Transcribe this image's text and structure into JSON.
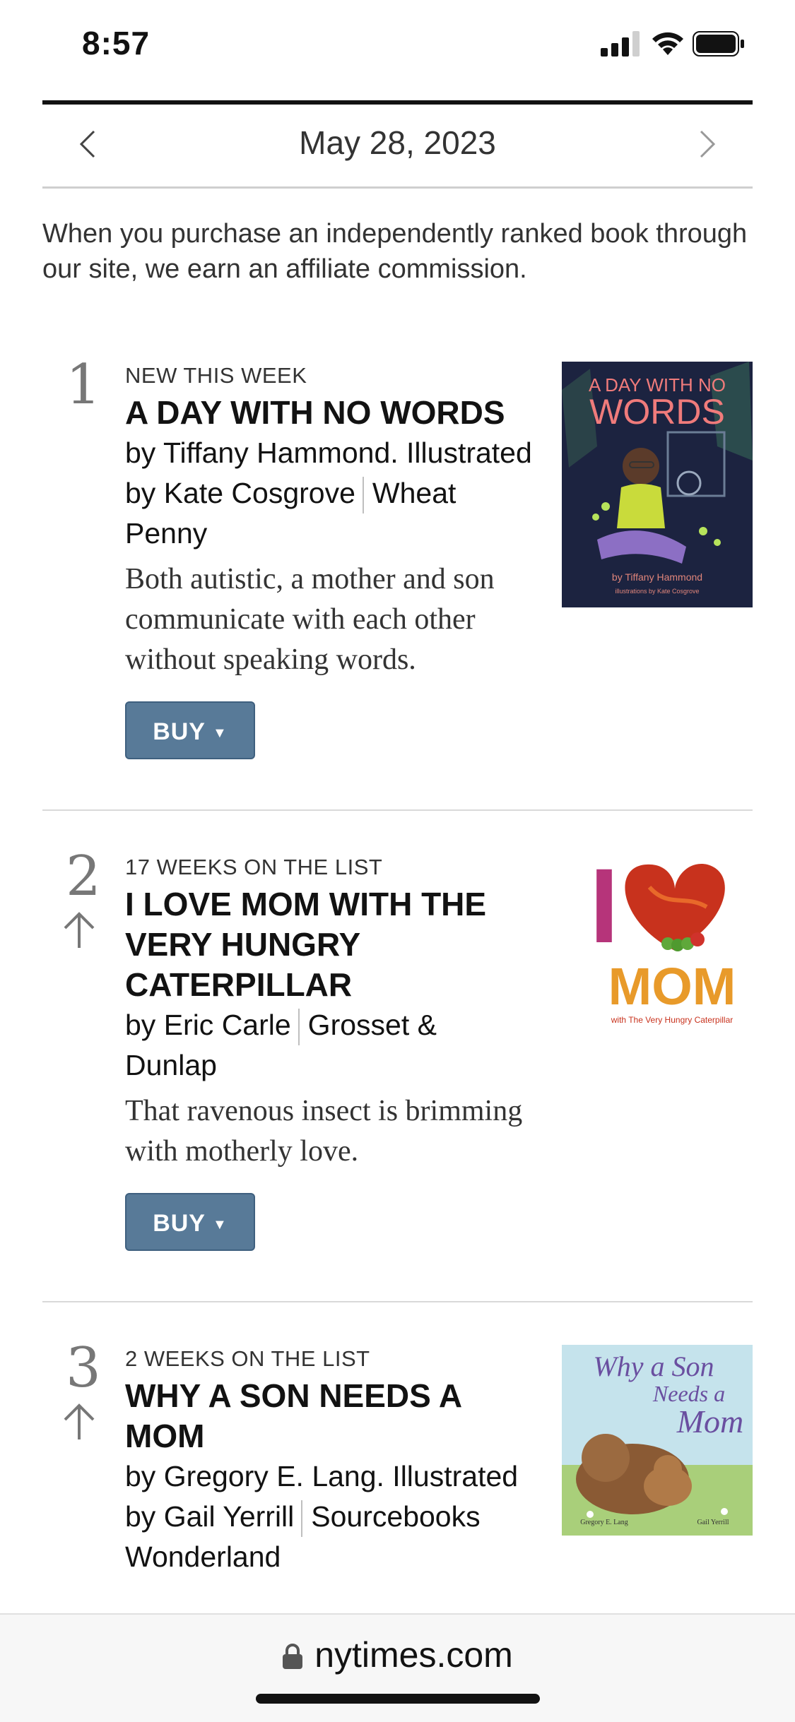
{
  "status": {
    "time": "8:57"
  },
  "nav": {
    "date": "May 28, 2023"
  },
  "disclaimer": "When you purchase an independently ranked book through our site, we earn an affiliate commission.",
  "books": [
    {
      "rank": "1",
      "weeks": "NEW THIS WEEK",
      "title": "A DAY WITH NO WORDS",
      "author": "by Tiffany Hammond. Illustrated by Kate Cosgrove",
      "publisher": "Wheat Penny",
      "description": "Both autistic, a mother and son communicate with each other without speaking words.",
      "buy_label": "BUY",
      "cover": {
        "title_line1": "A DAY WITH NO",
        "title_line2": "WORDS",
        "author": "by Tiffany Hammond",
        "illustrator": "illustrations by Kate Cosgrove"
      }
    },
    {
      "rank": "2",
      "weeks": "17 WEEKS ON THE LIST",
      "title": "I LOVE MOM WITH THE VERY HUNGRY CATERPILLAR",
      "author": "by Eric Carle",
      "publisher": "Grosset & Dunlap",
      "description": "That ravenous insect is brimming with motherly love.",
      "buy_label": "BUY",
      "cover": {
        "letter": "I",
        "word": "MOM",
        "subtitle": "with The Very Hungry Caterpillar"
      }
    },
    {
      "rank": "3",
      "weeks": "2 WEEKS ON THE LIST",
      "title": "WHY A SON NEEDS A MOM",
      "author": "by Gregory E. Lang. Illustrated by Gail Yerrill",
      "publisher": "Sourcebooks Wonderland",
      "cover": {
        "line1": "Why a Son",
        "line2": "Needs a",
        "line3": "Mom",
        "author": "Gregory E. Lang",
        "illustrator": "Gail Yerrill"
      }
    }
  ],
  "browser": {
    "url": "nytimes.com"
  }
}
